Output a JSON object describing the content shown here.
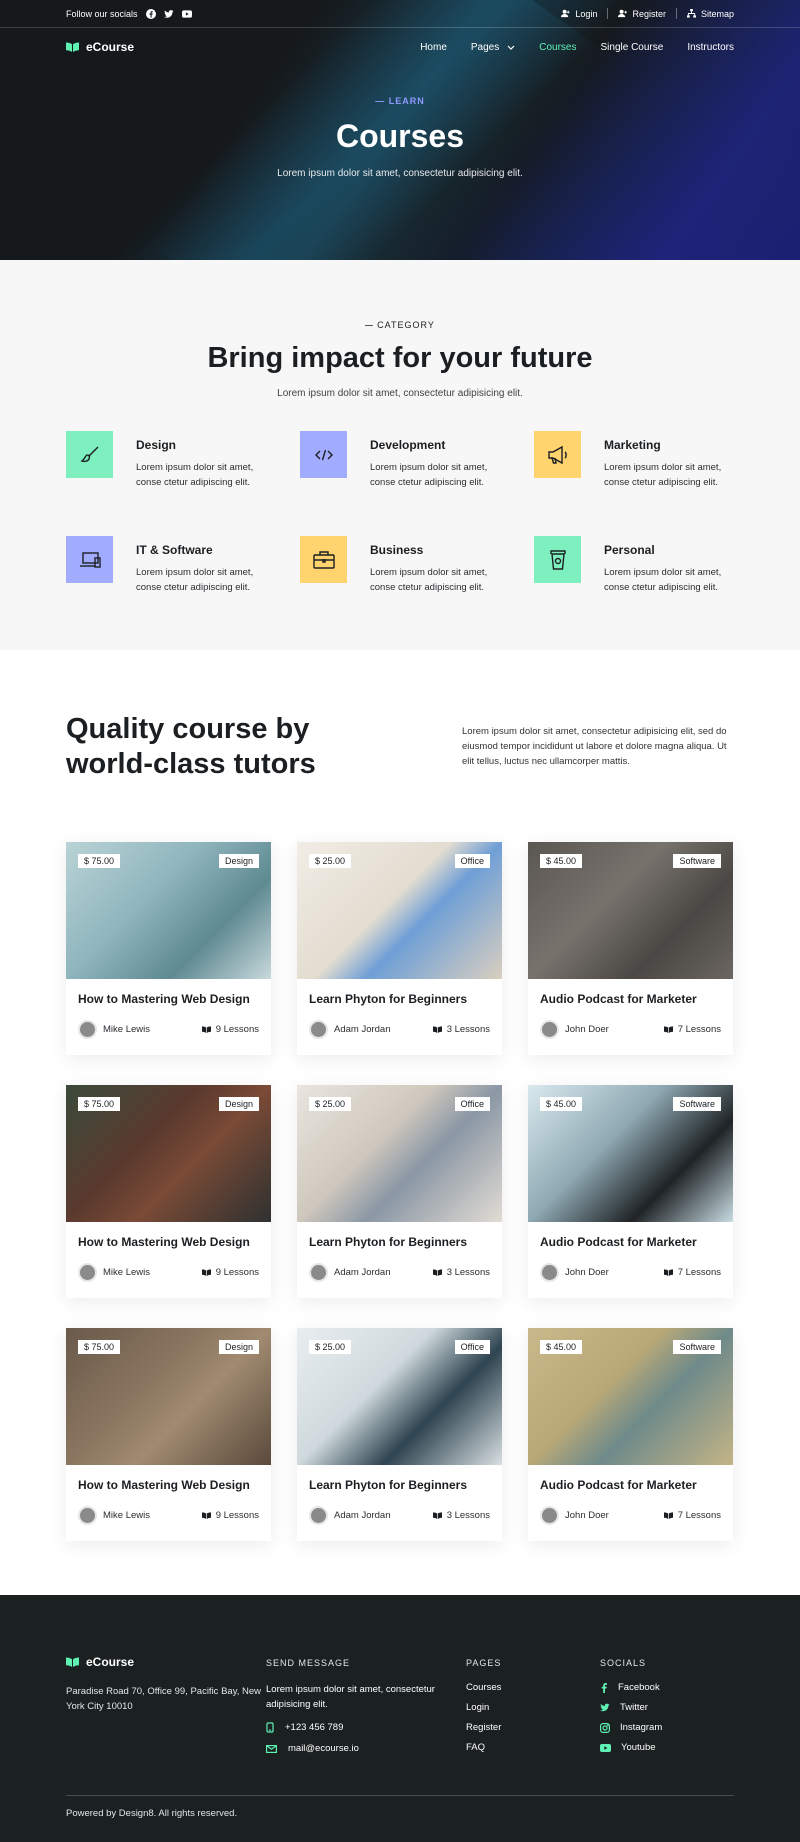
{
  "topbar": {
    "follow_label": "Follow our socials",
    "social_icons": [
      "facebook-icon",
      "twitter-icon",
      "youtube-icon"
    ],
    "links": [
      "Login",
      "Register",
      "Sitemap"
    ]
  },
  "navbar": {
    "brand": "eCourse",
    "items": [
      "Home",
      "Pages",
      "Courses",
      "Single Course",
      "Instructors"
    ],
    "active": "Courses"
  },
  "hero": {
    "eyebrow": "— LEARN",
    "title": "Courses",
    "subtitle": "Lorem ipsum dolor sit amet, consectetur adipisicing elit."
  },
  "category": {
    "eyebrow": "CATEGORY",
    "title": "Bring impact for your future",
    "subtitle": "Lorem ipsum dolor sit amet, consectetur adipisicing elit.",
    "items": [
      {
        "name": "Design",
        "desc1": "Lorem ipsum dolor sit amet,",
        "desc2": "conse ctetur adipiscing elit.",
        "icon": "brush-icon",
        "color": "#7ef0bf"
      },
      {
        "name": "Development",
        "desc1": "Lorem ipsum dolor sit amet,",
        "desc2": "conse ctetur adipiscing elit.",
        "icon": "code-icon",
        "color": "#a2acff"
      },
      {
        "name": "Marketing",
        "desc1": "Lorem ipsum dolor sit amet,",
        "desc2": "conse ctetur adipiscing elit.",
        "icon": "megaphone-icon",
        "color": "#ffd36e"
      },
      {
        "name": "IT & Software",
        "desc1": "Lorem ipsum dolor sit amet,",
        "desc2": "conse ctetur adipiscing elit.",
        "icon": "devices-icon",
        "color": "#a2acff"
      },
      {
        "name": "Business",
        "desc1": "Lorem ipsum dolor sit amet,",
        "desc2": "conse ctetur adipiscing elit.",
        "icon": "briefcase-icon",
        "color": "#ffd36e"
      },
      {
        "name": "Personal",
        "desc1": "Lorem ipsum dolor sit amet,",
        "desc2": "conse ctetur adipiscing elit.",
        "icon": "cup-icon",
        "color": "#7ef0bf"
      }
    ]
  },
  "quality": {
    "title": "Quality course by world-class tutors",
    "description": "Lorem ipsum dolor sit amet, consectetur adipisicing elit, sed do eiusmod tempor incididunt ut labore et dolore magna aliqua. Ut elit tellus, luctus nec ullamcorper mattis."
  },
  "courses": [
    {
      "price": "$ 75.00",
      "tag": "Design",
      "title": "How to Mastering Web Design",
      "author": "Mike Lewis",
      "lessons": "9 Lessons"
    },
    {
      "price": "$ 25.00",
      "tag": "Office",
      "title": "Learn Phyton for Beginners",
      "author": "Adam Jordan",
      "lessons": "3 Lessons"
    },
    {
      "price": "$ 45.00",
      "tag": "Software",
      "title": "Audio Podcast for Marketer",
      "author": "John Doer",
      "lessons": "7 Lessons"
    },
    {
      "price": "$ 75.00",
      "tag": "Design",
      "title": "How to Mastering Web Design",
      "author": "Mike Lewis",
      "lessons": "9 Lessons"
    },
    {
      "price": "$ 25.00",
      "tag": "Office",
      "title": "Learn Phyton for Beginners",
      "author": "Adam Jordan",
      "lessons": "3 Lessons"
    },
    {
      "price": "$ 45.00",
      "tag": "Software",
      "title": "Audio Podcast for Marketer",
      "author": "John Doer",
      "lessons": "7 Lessons"
    },
    {
      "price": "$ 75.00",
      "tag": "Design",
      "title": "How to Mastering Web Design",
      "author": "Mike Lewis",
      "lessons": "9 Lessons"
    },
    {
      "price": "$ 25.00",
      "tag": "Office",
      "title": "Learn Phyton for Beginners",
      "author": "Adam Jordan",
      "lessons": "3 Lessons"
    },
    {
      "price": "$ 45.00",
      "tag": "Software",
      "title": "Audio Podcast for Marketer",
      "author": "John Doer",
      "lessons": "7 Lessons"
    }
  ],
  "footer": {
    "brand": "eCourse",
    "address": "Paradise Road 70, Office 99, Pacific Bay,  New York City 10010",
    "send_heading": "SEND MESSAGE",
    "send_text": "Lorem ipsum dolor sit amet, consectetur adipisicing elit.",
    "phone": "+123 456 789",
    "email": "mail@ecourse.io",
    "pages_heading": "PAGES",
    "pages": [
      "Courses",
      "Login",
      "Register",
      "FAQ"
    ],
    "socials_heading": "SOCIALS",
    "socials": [
      "Facebook",
      "Twitter",
      "Instagram",
      "Youtube"
    ],
    "copyright": "Powered by Design8. All rights reserved."
  },
  "colors": {
    "accent_green": "#5ff0b4",
    "accent_purple": "#8f9bff",
    "footer_bg": "#1b2021"
  }
}
